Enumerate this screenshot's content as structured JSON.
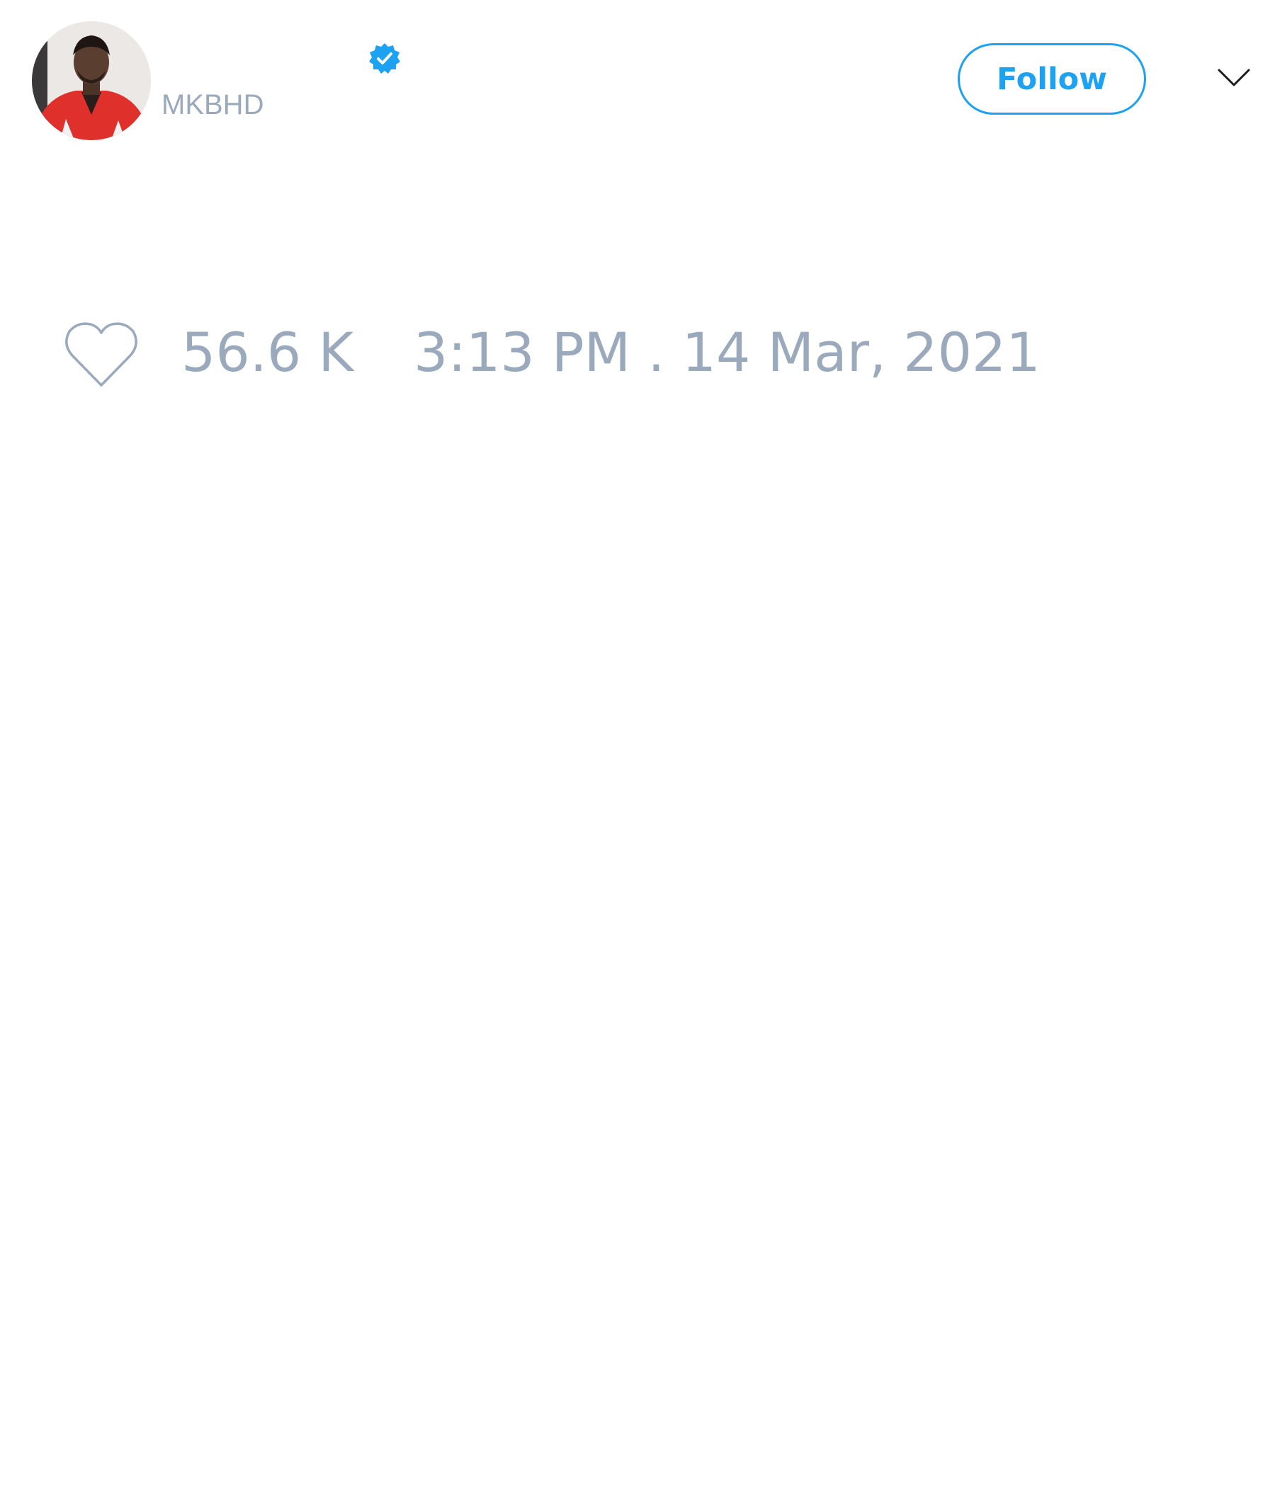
{
  "author": {
    "handle": "MKBHD",
    "verified": true
  },
  "header": {
    "follow_label": "Follow",
    "menu_icon": "chevron-down-icon"
  },
  "tweet": {
    "like_count": "56.6 K",
    "timestamp": "3:13 PM . 14 Mar, 2021"
  },
  "colors": {
    "accent": "#1da1f2",
    "muted_text": "#9aa9bc",
    "background": "#ffffff"
  }
}
